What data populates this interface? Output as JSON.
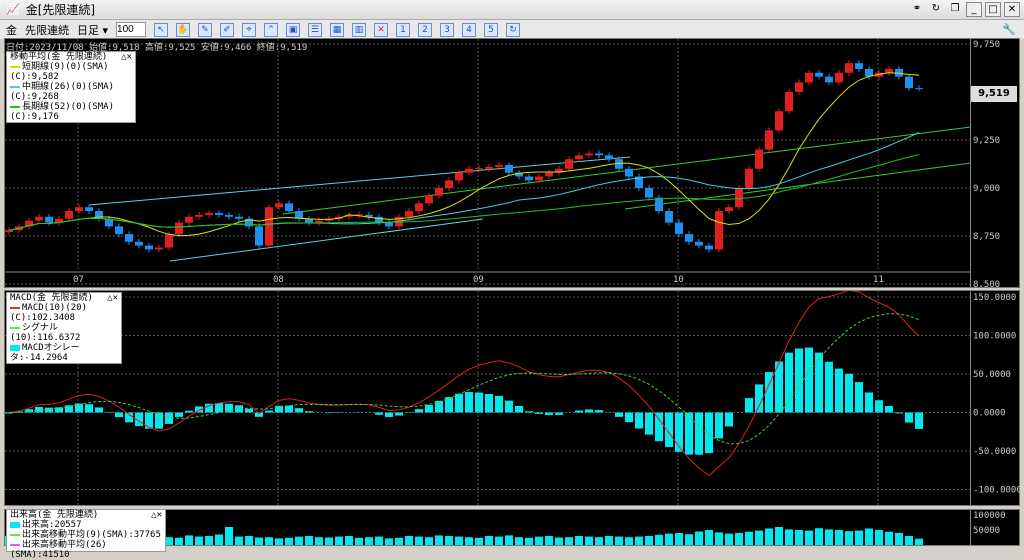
{
  "window": {
    "title": "金[先限連続]"
  },
  "toolbar": {
    "symbol": "金",
    "contract": "先限連続",
    "period": "日足",
    "count": "100"
  },
  "info": {
    "text": "日付:2023/11/08 始値:9,518 高値:9,525 安値:9,466 終値:9,519"
  },
  "ma_legend": {
    "title": "移動平均(金 先限連続)",
    "short": "短期線(9)(0)(SMA)(C):9,582",
    "mid": "中期線(26)(0)(SMA)(C):9,268",
    "long": "長期線(52)(0)(SMA)(C):9,176",
    "colors": {
      "short": "#e0e000",
      "mid": "#40d0e0",
      "long": "#20c020"
    }
  },
  "macd_legend": {
    "title": "MACD(金 先限連続)",
    "macd": "MACD(10)(20)(C):102.3408",
    "signal": "シグナル(10):116.6372",
    "osc": "MACDオシレータ:-14.2964"
  },
  "vol_legend": {
    "title": "出来高(金 先限連続)",
    "vol": "出来高:20557",
    "ma9": "出来高移動平均(9)(SMA):37765",
    "ma26": "出来高移動平均(26)(SMA):41510"
  },
  "last_price": "9,519",
  "chart_data": {
    "type": "candlestick",
    "price_ticks": [
      "9,750",
      "9,250",
      "9,000",
      "8,750",
      "8,500"
    ],
    "price_tick_values": [
      9750,
      9250,
      9000,
      8750,
      8500
    ],
    "price_range": [
      8500,
      9750
    ],
    "x_labels": [
      "07",
      "08",
      "09",
      "10",
      "11"
    ],
    "x_label_index": [
      7,
      27,
      47,
      67,
      87
    ],
    "closes": [
      8780,
      8800,
      8830,
      8850,
      8820,
      8840,
      8880,
      8900,
      8880,
      8840,
      8800,
      8760,
      8720,
      8700,
      8680,
      8690,
      8760,
      8820,
      8850,
      8860,
      8870,
      8860,
      8850,
      8840,
      8800,
      8700,
      8900,
      8920,
      8880,
      8840,
      8820,
      8830,
      8840,
      8850,
      8860,
      8860,
      8850,
      8820,
      8800,
      8850,
      8880,
      8920,
      8960,
      9000,
      9040,
      9080,
      9100,
      9100,
      9110,
      9120,
      9080,
      9060,
      9040,
      9060,
      9080,
      9100,
      9150,
      9170,
      9180,
      9170,
      9150,
      9100,
      9060,
      9000,
      8950,
      8880,
      8820,
      8760,
      8720,
      8700,
      8680,
      8880,
      8900,
      9000,
      9100,
      9200,
      9300,
      9400,
      9500,
      9550,
      9600,
      9580,
      9550,
      9600,
      9650,
      9620,
      9580,
      9600,
      9620,
      9580,
      9520,
      9519
    ],
    "macd_ticks": [
      "150.0000",
      "100.0000",
      "50.0000",
      "0.0000",
      "-50.0000",
      "-100.0000"
    ],
    "macd_tick_values": [
      150,
      100,
      50,
      0,
      -50,
      -100
    ],
    "volume_ticks": [
      "100000",
      "50000"
    ],
    "volumes": [
      30,
      25,
      28,
      20,
      35,
      22,
      30,
      26,
      24,
      28,
      22,
      30,
      25,
      27,
      30,
      28,
      26,
      24,
      32,
      28,
      30,
      35,
      60,
      28,
      30,
      25,
      26,
      22,
      24,
      28,
      30,
      26,
      25,
      28,
      30,
      24,
      26,
      28,
      22,
      24,
      30,
      28,
      26,
      32,
      30,
      28,
      26,
      24,
      30,
      28,
      32,
      26,
      24,
      28,
      30,
      25,
      26,
      30,
      28,
      26,
      30,
      28,
      26,
      28,
      30,
      34,
      38,
      40,
      36,
      45,
      50,
      42,
      38,
      40,
      44,
      48,
      55,
      60,
      52,
      50,
      48,
      56,
      52,
      50,
      46,
      48,
      55,
      50,
      44,
      40,
      30,
      21
    ]
  }
}
